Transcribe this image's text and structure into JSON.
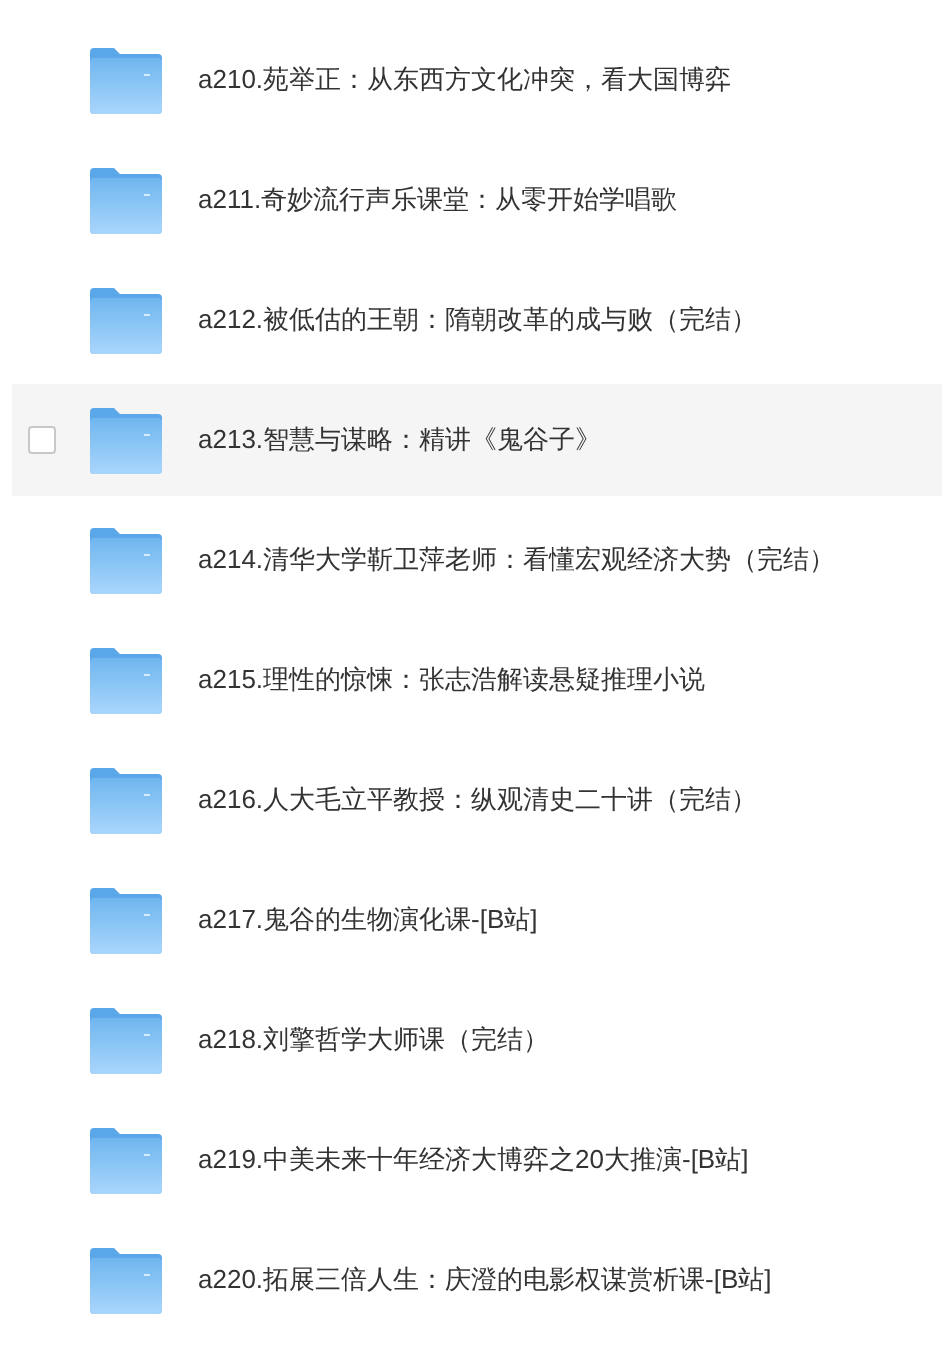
{
  "folders": [
    {
      "name": "a210.苑举正：从东西方文化冲突，看大国博弈",
      "hovered": false,
      "checked": false
    },
    {
      "name": "a211.奇妙流行声乐课堂：从零开始学唱歌",
      "hovered": false,
      "checked": false
    },
    {
      "name": "a212.被低估的王朝：隋朝改革的成与败（完结）",
      "hovered": false,
      "checked": false
    },
    {
      "name": "a213.智慧与谋略：精讲《鬼谷子》",
      "hovered": true,
      "checked": false
    },
    {
      "name": "a214.清华大学靳卫萍老师：看懂宏观经济大势（完结）",
      "hovered": false,
      "checked": false
    },
    {
      "name": "a215.理性的惊悚：张志浩解读悬疑推理小说",
      "hovered": false,
      "checked": false
    },
    {
      "name": "a216.人大毛立平教授：纵观清史二十讲（完结）",
      "hovered": false,
      "checked": false
    },
    {
      "name": "a217.鬼谷的生物演化课-[B站]",
      "hovered": false,
      "checked": false
    },
    {
      "name": "a218.刘擎哲学大师课（完结）",
      "hovered": false,
      "checked": false
    },
    {
      "name": "a219.中美未来十年经济大博弈之20大推演-[B站]",
      "hovered": false,
      "checked": false
    },
    {
      "name": "a220.拓展三倍人生：庆澄的电影权谋赏析课-[B站]",
      "hovered": false,
      "checked": false
    }
  ]
}
